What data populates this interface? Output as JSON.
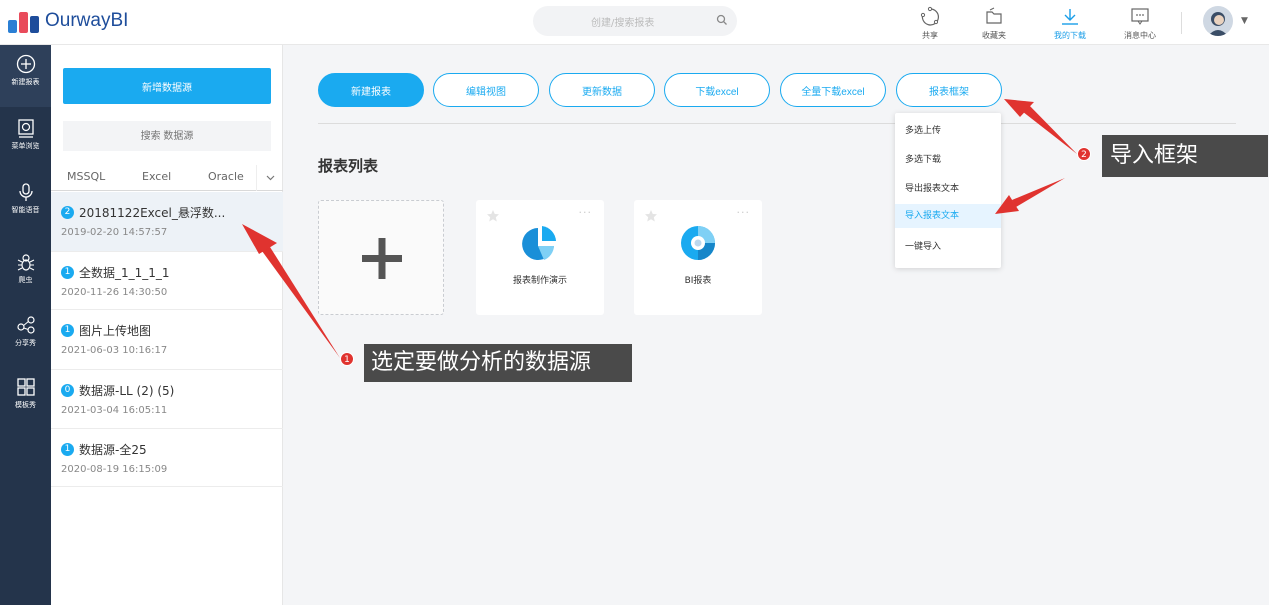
{
  "header": {
    "logo_text": "OurwayBI",
    "search_placeholder": "创建/搜索报表",
    "icons": [
      {
        "label": "共享",
        "icon": "share-icon"
      },
      {
        "label": "收藏夹",
        "icon": "folder-icon"
      },
      {
        "label": "我的下载",
        "icon": "download-icon",
        "active": true
      },
      {
        "label": "消息中心",
        "icon": "message-icon"
      }
    ]
  },
  "leftnav": [
    {
      "label": "新建报表",
      "icon": "plus-circle-icon"
    },
    {
      "label": "菜单浏览",
      "icon": "menu-browse-icon"
    },
    {
      "label": "智能语音",
      "icon": "microphone-icon"
    },
    {
      "label": "爬虫",
      "icon": "spider-icon"
    },
    {
      "label": "分享秀",
      "icon": "share-nodes-icon"
    },
    {
      "label": "模板秀",
      "icon": "template-grid-icon"
    }
  ],
  "panel": {
    "new_datasource_label": "新增数据源",
    "search_placeholder": "搜索 数据源",
    "types": [
      "MSSQL",
      "Excel",
      "Oracle"
    ],
    "datasources": [
      {
        "badge": "2",
        "name": "20181122Excel_悬浮数...",
        "date": "2019-02-20 14:57:57"
      },
      {
        "badge": "1",
        "name": "全数据_1_1_1_1",
        "date": "2020-11-26 14:30:50"
      },
      {
        "badge": "1",
        "name": "图片上传地图",
        "date": "2021-06-03 10:16:17"
      },
      {
        "badge": "0",
        "name": "数据源-LL (2) (5)",
        "date": "2021-03-04 16:05:11"
      },
      {
        "badge": "1",
        "name": "数据源-全25",
        "date": "2020-08-19 16:15:09"
      }
    ]
  },
  "toolbar": {
    "buttons": [
      "新建报表",
      "编辑视图",
      "更新数据",
      "下载excel",
      "全量下载excel",
      "报表框架"
    ]
  },
  "report_list": {
    "title": "报表列表",
    "cards": [
      {
        "label": "报表制作演示",
        "icon": "pie-chart-icon"
      },
      {
        "label": "BI报表",
        "icon": "donut-chart-icon"
      }
    ]
  },
  "dropdown": {
    "items": [
      "多选上传",
      "多选下载",
      "导出报表文本",
      "导入报表文本",
      "一键导入"
    ],
    "highlighted_index": 3
  },
  "annotations": {
    "callout1": {
      "number": "1",
      "text": "选定要做分析的数据源"
    },
    "callout2": {
      "number": "2",
      "text": "导入框架"
    }
  },
  "colors": {
    "accent": "#1aaaf0",
    "nav_bg": "#24344b",
    "annotation_red": "#e0332f"
  }
}
